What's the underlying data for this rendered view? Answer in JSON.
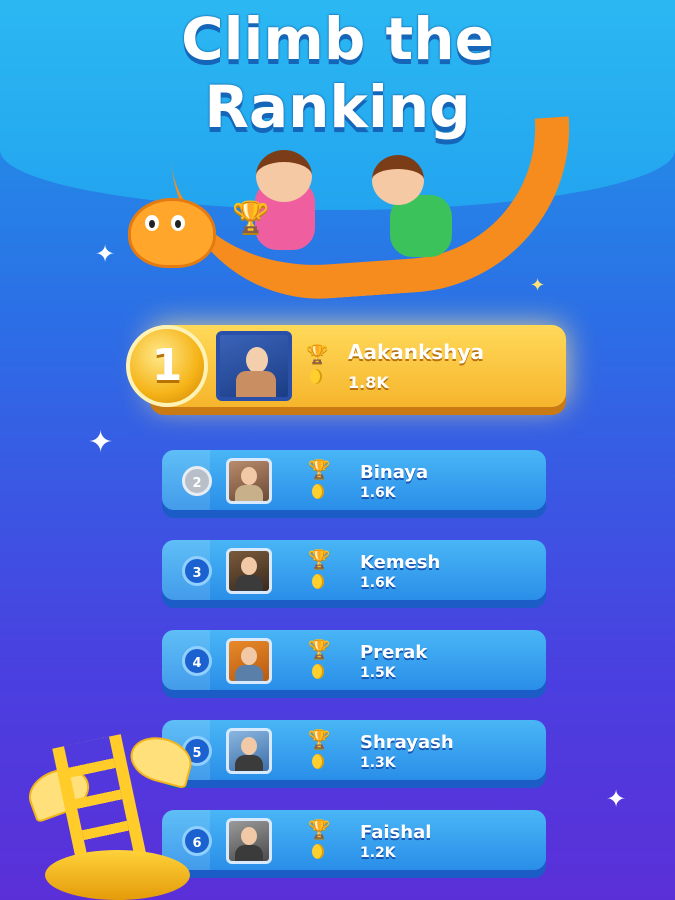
{
  "title": {
    "line1": "Climb the",
    "line2": "Ranking"
  },
  "leaderboard": {
    "first": {
      "rank": "1",
      "name": "Aakankshya",
      "score": "1.8K"
    },
    "rows": [
      {
        "rank": "2",
        "name": "Binaya",
        "score": "1.6K"
      },
      {
        "rank": "3",
        "name": "Kemesh",
        "score": "1.6K"
      },
      {
        "rank": "4",
        "name": "Prerak",
        "score": "1.5K"
      },
      {
        "rank": "5",
        "name": "Shrayash",
        "score": "1.3K"
      },
      {
        "rank": "6",
        "name": "Faishal",
        "score": "1.2K"
      }
    ]
  },
  "icons": [
    "trophy-icon",
    "coin-icon",
    "sparkle-icon",
    "medal-icon",
    "ladder-trophy-icon"
  ],
  "colors": {
    "gold": "#f6b52c",
    "row_blue": "#2a8ee8",
    "background_top": "#23a4ef",
    "background_bottom": "#5b2fd8"
  }
}
